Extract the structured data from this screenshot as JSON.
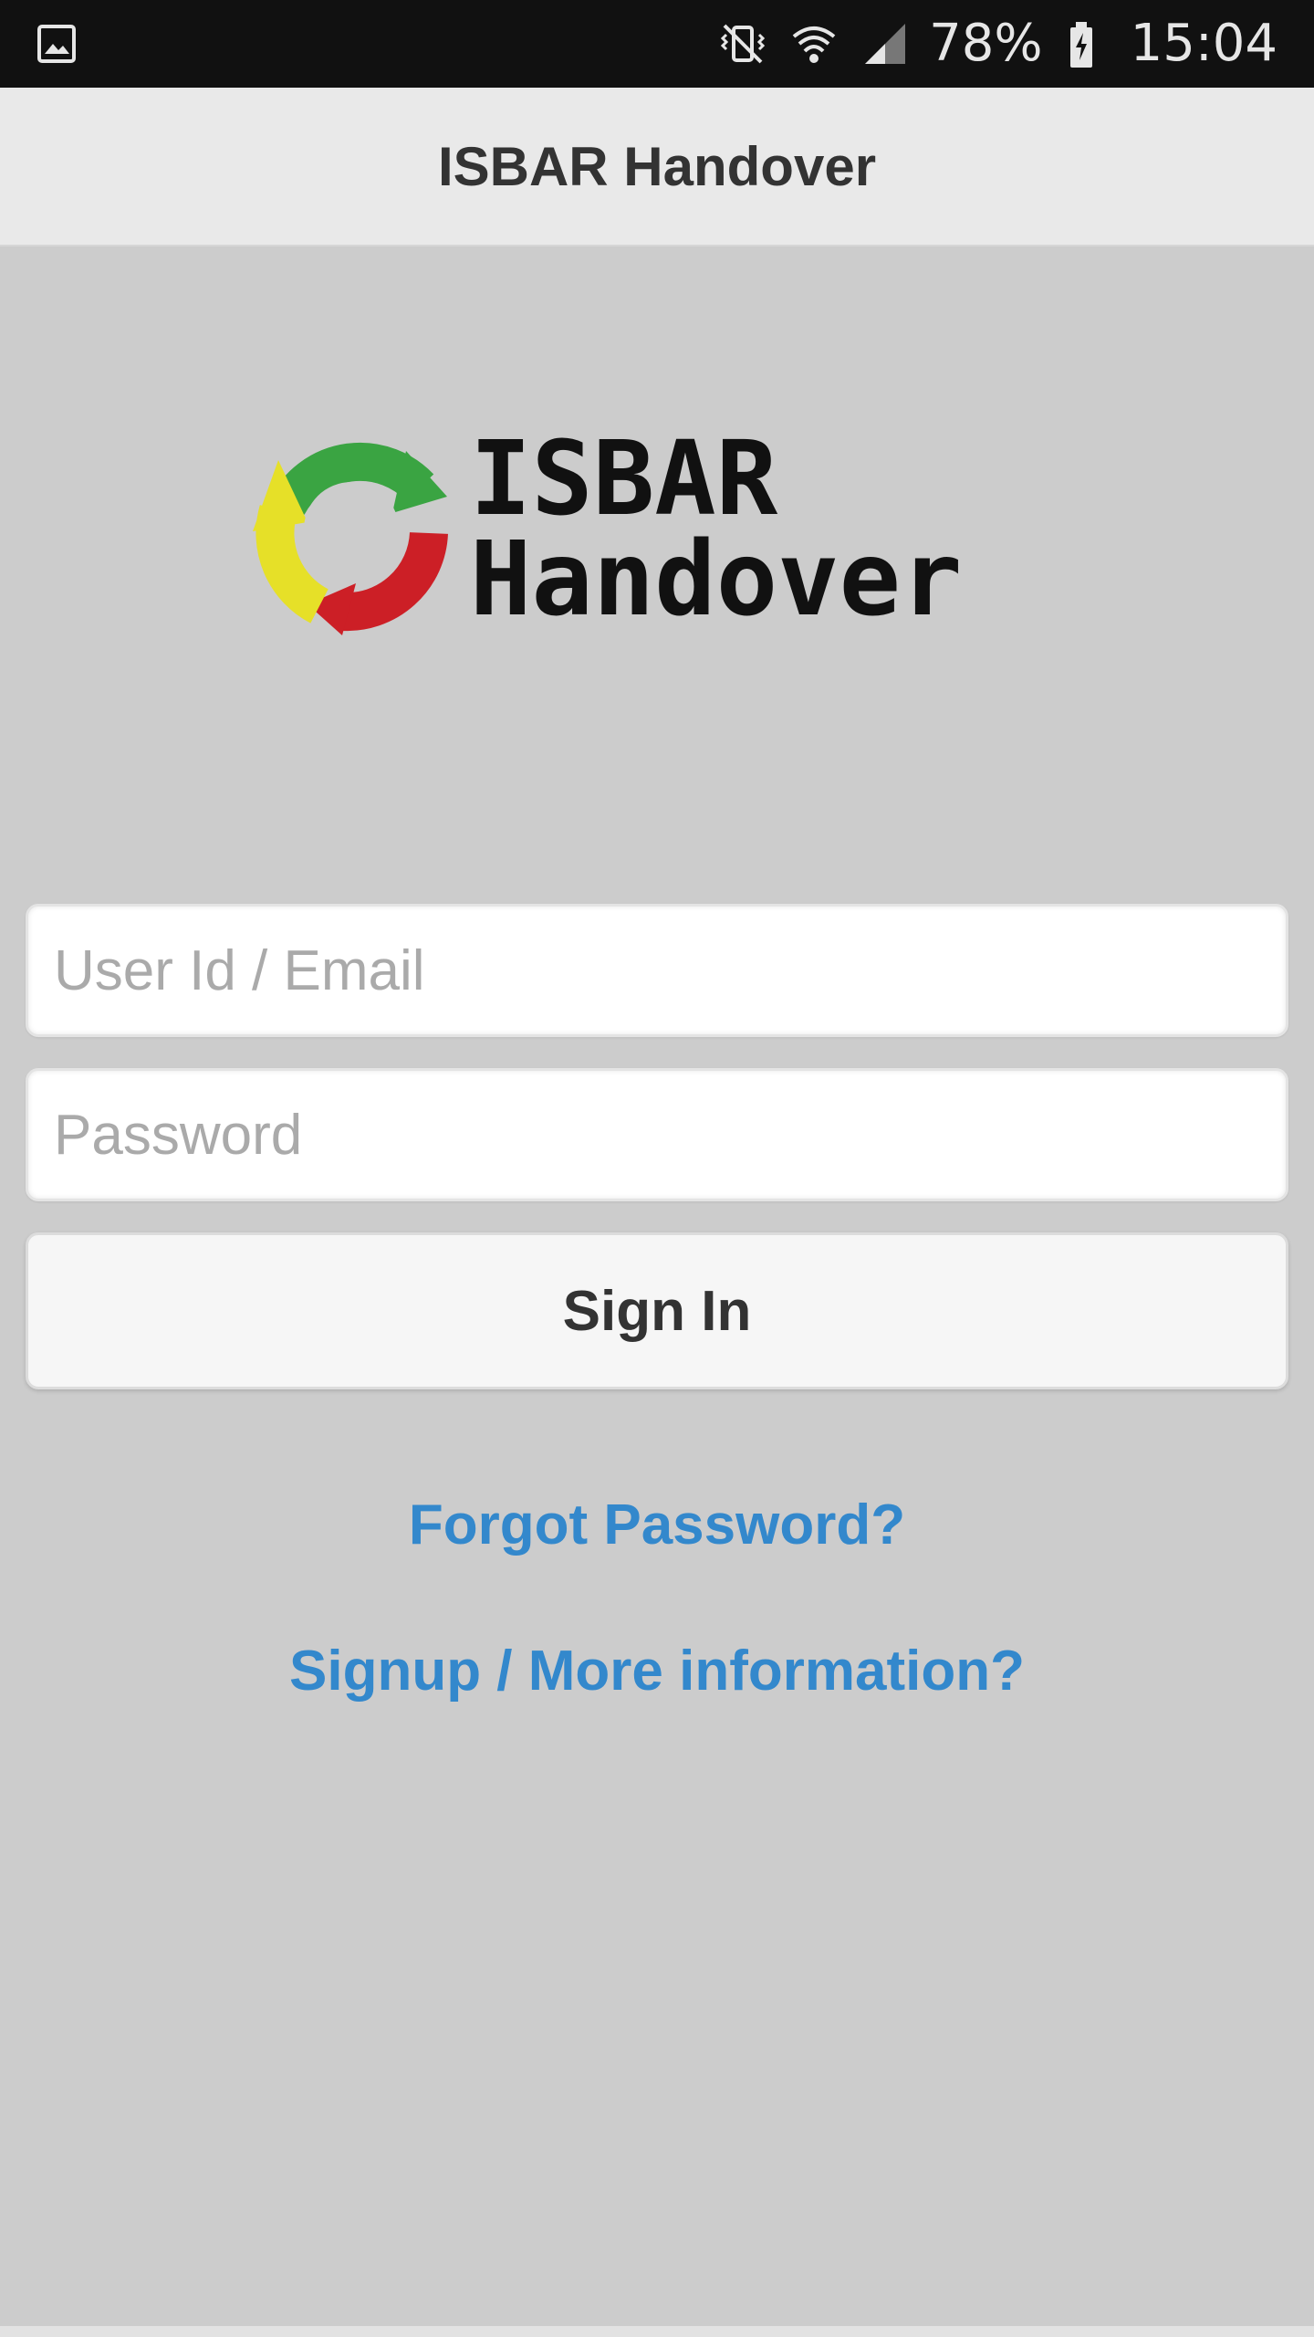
{
  "status_bar": {
    "battery": "78%",
    "time": "15:04",
    "icons": [
      "image-notification-icon",
      "vibrate-mute-icon",
      "wifi-icon",
      "cell-signal-icon",
      "battery-charging-icon"
    ]
  },
  "header": {
    "title": "ISBAR Handover"
  },
  "logo": {
    "line1": "ISBAR",
    "line2": "Handover",
    "colors": {
      "green": "#3aa442",
      "red": "#cc1f26",
      "yellow": "#e6e028"
    }
  },
  "form": {
    "user_placeholder": "User Id / Email",
    "user_value": "",
    "password_placeholder": "Password",
    "password_value": "",
    "signin_label": "Sign In"
  },
  "links": {
    "forgot": "Forgot Password?",
    "signup": "Signup / More information?"
  },
  "colors": {
    "background": "#cccccc",
    "header_bg": "#e9e9e9",
    "link": "#3388cc"
  }
}
